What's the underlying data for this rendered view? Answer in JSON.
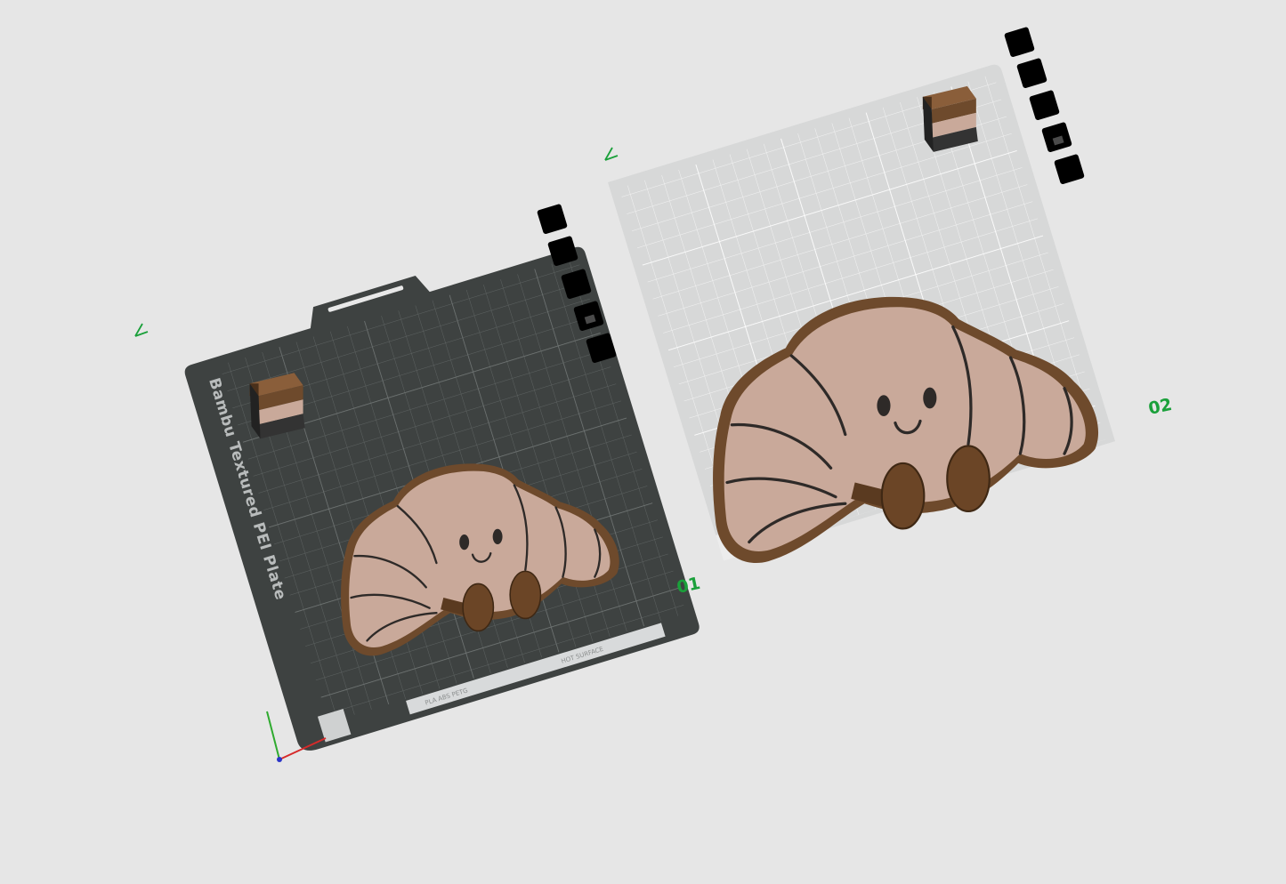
{
  "viewport": {
    "background": "#e6e6e6",
    "accent_label_color": "#1aa03a"
  },
  "plates": [
    {
      "id": "plate-1",
      "label": "01",
      "bed_name": "Bambu Textured PEI Plate",
      "bed_material_tag": "PLA ABS PETG",
      "bed_hot_tag": "HOT SURFACE",
      "bed_color": "#3e4241",
      "buttons": [
        "close-icon",
        "auto-orient-icon",
        "arrange-icon",
        "lock-icon",
        "settings-icon"
      ]
    },
    {
      "id": "plate-2",
      "label": "02",
      "bed_color": "#d7d8d8",
      "buttons": [
        "close-icon",
        "auto-orient-icon",
        "arrange-icon",
        "lock-icon",
        "settings-icon"
      ]
    }
  ],
  "model": {
    "name": "croissant",
    "colors": {
      "outline": "#6e4a2c",
      "body": "#c9a99a",
      "dark_line": "#2e2a28",
      "wheels": "#6b4526"
    }
  },
  "wipe_tower_colors": [
    "#6e4a2c",
    "#c9a99a",
    "#333333"
  ]
}
